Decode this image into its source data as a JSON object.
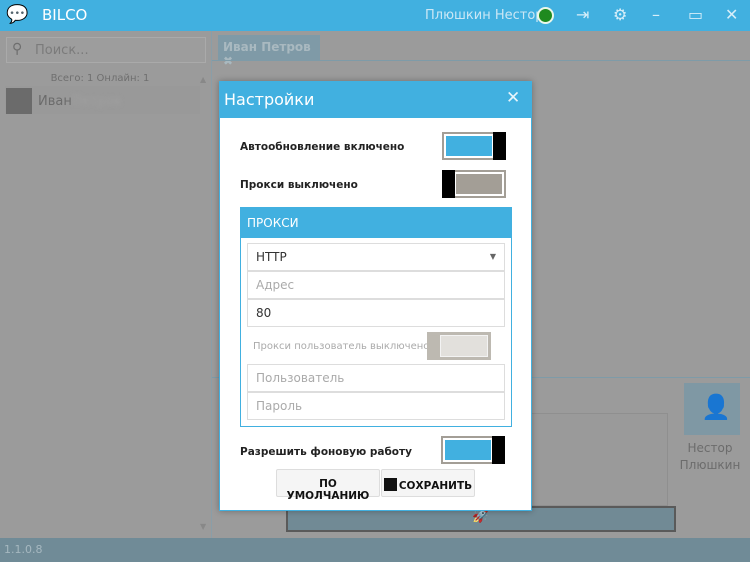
{
  "app": {
    "title": "BILCO",
    "user_name": "Плюшкин Нестор",
    "version": "1.1.0.8",
    "accent": "#41b0e0"
  },
  "sidebar": {
    "search_placeholder": "Поиск...",
    "counts": "Всего: 1 Онлайн: 1",
    "contacts": [
      {
        "first": "Иван",
        "last": "Петров"
      }
    ]
  },
  "chat": {
    "tab_label": "Иван Петров",
    "peer_name_1": "Нестор",
    "peer_name_2": "Плюшкин"
  },
  "dialog": {
    "title": "Настройки",
    "autoupdate_label": "Автообновление включено",
    "autoupdate_on": true,
    "proxy_label": "Прокси выключено",
    "proxy_on": false,
    "proxy_section": "ПРОКСИ",
    "proxy_type": "HTTP",
    "address_placeholder": "Адрес",
    "port": "80",
    "proxy_user_label": "Прокси пользователь выключено",
    "proxy_user_on": false,
    "user_placeholder": "Пользователь",
    "password_placeholder": "Пароль",
    "background_label": "Разрешить фоновую работу",
    "background_on": true,
    "default_button": "ПО УМОЛЧАНИЮ",
    "save_button": "СОХРАНИТЬ"
  }
}
